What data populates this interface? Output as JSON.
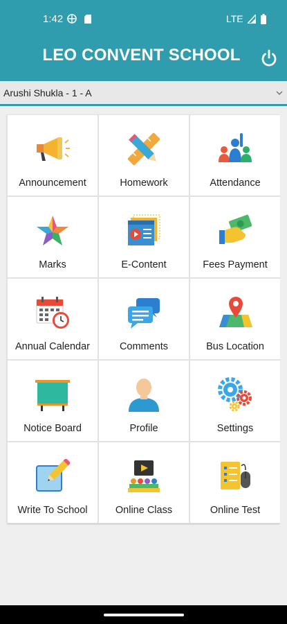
{
  "status_bar": {
    "time": "1:42",
    "network": "LTE"
  },
  "header": {
    "title": "LEO CONVENT SCHOOL"
  },
  "student_selector": {
    "selected": "Arushi Shukla - 1 - A"
  },
  "menu": [
    {
      "label": "Announcement",
      "icon": "megaphone-icon"
    },
    {
      "label": "Homework",
      "icon": "pencil-ruler-icon"
    },
    {
      "label": "Attendance",
      "icon": "attendance-icon"
    },
    {
      "label": "Marks",
      "icon": "star-icon"
    },
    {
      "label": "E-Content",
      "icon": "video-content-icon"
    },
    {
      "label": "Fees Payment",
      "icon": "money-hand-icon"
    },
    {
      "label": "Annual Calendar",
      "icon": "calendar-clock-icon"
    },
    {
      "label": "Comments",
      "icon": "chat-bubbles-icon"
    },
    {
      "label": "Bus Location",
      "icon": "map-pin-icon"
    },
    {
      "label": "Notice Board",
      "icon": "notice-board-icon"
    },
    {
      "label": "Profile",
      "icon": "user-icon"
    },
    {
      "label": "Settings",
      "icon": "gears-icon"
    },
    {
      "label": "Write To School",
      "icon": "write-pencil-icon"
    },
    {
      "label": "Online Class",
      "icon": "online-class-icon"
    },
    {
      "label": "Online Test",
      "icon": "test-mouse-icon"
    }
  ],
  "colors": {
    "primary": "#2f9dad",
    "background": "#efefef"
  }
}
